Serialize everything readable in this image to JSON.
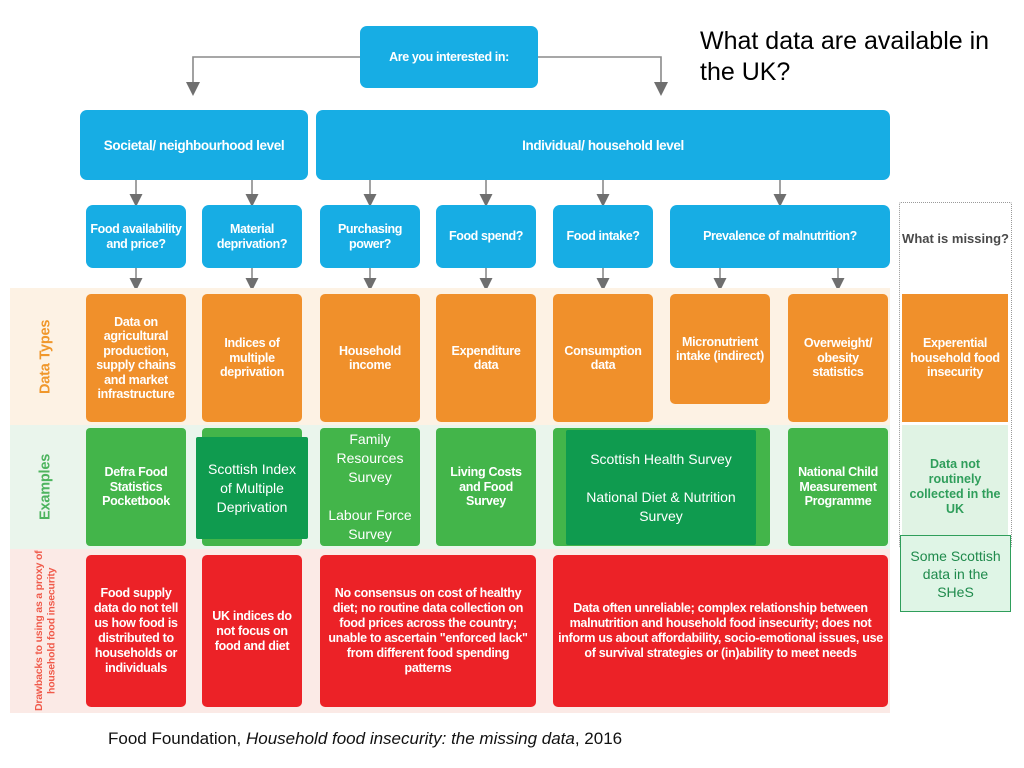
{
  "title": "What data are available in the UK?",
  "root_question": "Are you interested in:",
  "levels": [
    {
      "label": "Societal/ neighbourhood level"
    },
    {
      "label": "Individual/ household level"
    }
  ],
  "questions": [
    {
      "label": "Food availability and price?"
    },
    {
      "label": "Material deprivation?"
    },
    {
      "label": "Purchasing power?"
    },
    {
      "label": "Food spend?"
    },
    {
      "label": "Food intake?"
    },
    {
      "label": "Prevalence of malnutrition?"
    }
  ],
  "missing_column": {
    "header": "What is missing?",
    "data_type": "Experential household food insecurity",
    "example": "Data not routinely collected in the UK",
    "note": "Some Scottish data in the SHeS"
  },
  "rows": {
    "data_types_label": "Data Types",
    "examples_label": "Examples",
    "drawbacks_label": "Drawbacks to using as a proxy of household food insecurity"
  },
  "data_types": [
    {
      "label": "Data on agricultural production, supply chains and market infrastructure"
    },
    {
      "label": "Indices of multiple deprivation"
    },
    {
      "label": "Household income"
    },
    {
      "label": "Expenditure data"
    },
    {
      "label": "Consumption data"
    },
    {
      "label": "Micronutrient intake (indirect)"
    },
    {
      "label": "Overweight/ obesity statistics"
    }
  ],
  "examples": [
    {
      "label": "Defra Food Statistics Pocketbook"
    },
    {
      "label": "Scottish Index of Multiple Deprivation"
    },
    {
      "label": "Family Resources Survey\n\nLabour Force Survey"
    },
    {
      "label": "Living Costs and Food Survey"
    },
    {
      "label": "Scottish Health Survey\n\nNational Diet & Nutrition Survey"
    },
    {
      "label": "National Child Measurement Programme"
    }
  ],
  "drawbacks": [
    {
      "label": "Food supply data do not tell us how food is distributed to households or individuals"
    },
    {
      "label": "UK indices do not focus on food and diet"
    },
    {
      "label": "No consensus on cost of healthy diet; no routine data collection on food prices across the country; unable to ascertain \"enforced lack\" from different food spending patterns"
    },
    {
      "label": "Data often unreliable; complex relationship between malnutrition and household food insecurity; does not inform us about affordability, socio-emotional issues, use of survival strategies or (in)ability to meet needs"
    }
  ],
  "caption": {
    "source": "Food Foundation,",
    "work": "Household food insecurity: the missing data",
    "year": ", 2016"
  },
  "colors": {
    "blue": "#17ade4",
    "orange": "#f0902b",
    "green": "#43b54a",
    "green_dark": "#0f9b4f",
    "red": "#ec2227",
    "band_orange": "#fdf2e4",
    "band_green": "#eaf5ec",
    "band_red": "#fbeae6"
  }
}
